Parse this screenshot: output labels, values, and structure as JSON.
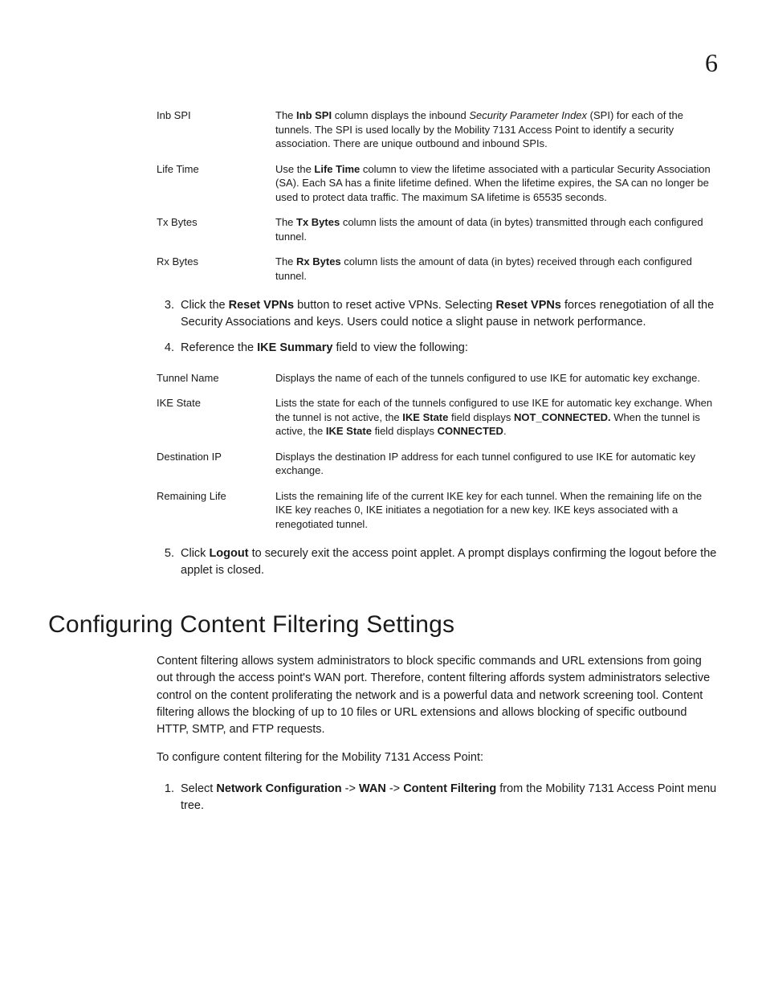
{
  "pageNumber": "6",
  "saFields": [
    {
      "term": "Inb SPI",
      "segments": [
        {
          "t": "The "
        },
        {
          "t": "Inb SPI",
          "b": true
        },
        {
          "t": " column displays the inbound "
        },
        {
          "t": "Security Parameter Index",
          "i": true
        },
        {
          "t": " (SPI) for each of the tunnels. The SPI is used locally by the Mobility 7131 Access Point to identify a security association. There are unique outbound and inbound SPIs."
        }
      ]
    },
    {
      "term": "Life Time",
      "segments": [
        {
          "t": "Use the "
        },
        {
          "t": "Life Time",
          "b": true
        },
        {
          "t": " column to view the lifetime associated with a particular Security Association (SA). Each SA has a finite lifetime defined. When the lifetime expires, the SA can no longer be used to protect data traffic. The maximum SA lifetime is 65535 seconds."
        }
      ]
    },
    {
      "term": "Tx Bytes",
      "segments": [
        {
          "t": "The "
        },
        {
          "t": "Tx Bytes",
          "b": true
        },
        {
          "t": " column lists the amount of data (in bytes) transmitted through each configured tunnel."
        }
      ]
    },
    {
      "term": "Rx Bytes",
      "segments": [
        {
          "t": "The "
        },
        {
          "t": "Rx Bytes",
          "b": true
        },
        {
          "t": " column lists the amount of data (in bytes) received through each configured tunnel."
        }
      ]
    }
  ],
  "stepsA_start": 3,
  "stepsA": [
    {
      "segments": [
        {
          "t": "Click the "
        },
        {
          "t": "Reset VPNs",
          "b": true
        },
        {
          "t": " button to reset active VPNs. Selecting "
        },
        {
          "t": "Reset VPNs",
          "b": true
        },
        {
          "t": " forces renegotiation of all the Security Associations and keys. Users could notice a slight pause in network performance."
        }
      ]
    },
    {
      "segments": [
        {
          "t": "Reference the "
        },
        {
          "t": "IKE Summary",
          "b": true
        },
        {
          "t": " field to view the following:"
        }
      ]
    }
  ],
  "ikeFields": [
    {
      "term": "Tunnel Name",
      "segments": [
        {
          "t": "Displays the name of each of the tunnels configured to use IKE for automatic key exchange."
        }
      ]
    },
    {
      "term": "IKE State",
      "segments": [
        {
          "t": "Lists the state for each of the tunnels configured to use IKE for automatic key exchange. When the tunnel is not active, the "
        },
        {
          "t": "IKE State",
          "b": true
        },
        {
          "t": " field displays "
        },
        {
          "t": "NOT_CONNECTED.",
          "b": true
        },
        {
          "t": " When the tunnel is active, the "
        },
        {
          "t": "IKE State",
          "b": true
        },
        {
          "t": " field displays "
        },
        {
          "t": "CONNECTED",
          "b": true
        },
        {
          "t": "."
        }
      ]
    },
    {
      "term": "Destination IP",
      "segments": [
        {
          "t": "Displays the destination IP address for each tunnel configured to use IKE for automatic key exchange."
        }
      ]
    },
    {
      "term": "Remaining Life",
      "segments": [
        {
          "t": "Lists the remaining life of the current IKE key for each tunnel. When the remaining life on the IKE key reaches 0, IKE initiates a negotiation for a new key. IKE keys associated with a renegotiated tunnel."
        }
      ]
    }
  ],
  "stepsB_start": 5,
  "stepsB": [
    {
      "segments": [
        {
          "t": "Click "
        },
        {
          "t": "Logout",
          "b": true
        },
        {
          "t": " to securely exit the access point applet. A prompt displays confirming the logout before the applet is closed."
        }
      ]
    }
  ],
  "sectionHeading": "Configuring Content Filtering Settings",
  "introPara": "Content filtering allows system administrators to block specific commands and URL extensions from going out through the access point's WAN port. Therefore, content filtering affords system administrators selective control on the content proliferating the network and is a powerful data and network screening tool. Content filtering allows the blocking of up to 10 files or URL extensions and allows blocking of specific outbound HTTP, SMTP, and FTP requests.",
  "introPara2": "To configure content filtering for the Mobility 7131 Access Point:",
  "stepsC_start": 1,
  "stepsC": [
    {
      "segments": [
        {
          "t": "Select "
        },
        {
          "t": "Network Configuration",
          "b": true
        },
        {
          "t": " -> "
        },
        {
          "t": "WAN",
          "b": true
        },
        {
          "t": " -> "
        },
        {
          "t": "Content Filtering",
          "b": true
        },
        {
          "t": " from the Mobility 7131 Access Point menu tree."
        }
      ]
    }
  ]
}
